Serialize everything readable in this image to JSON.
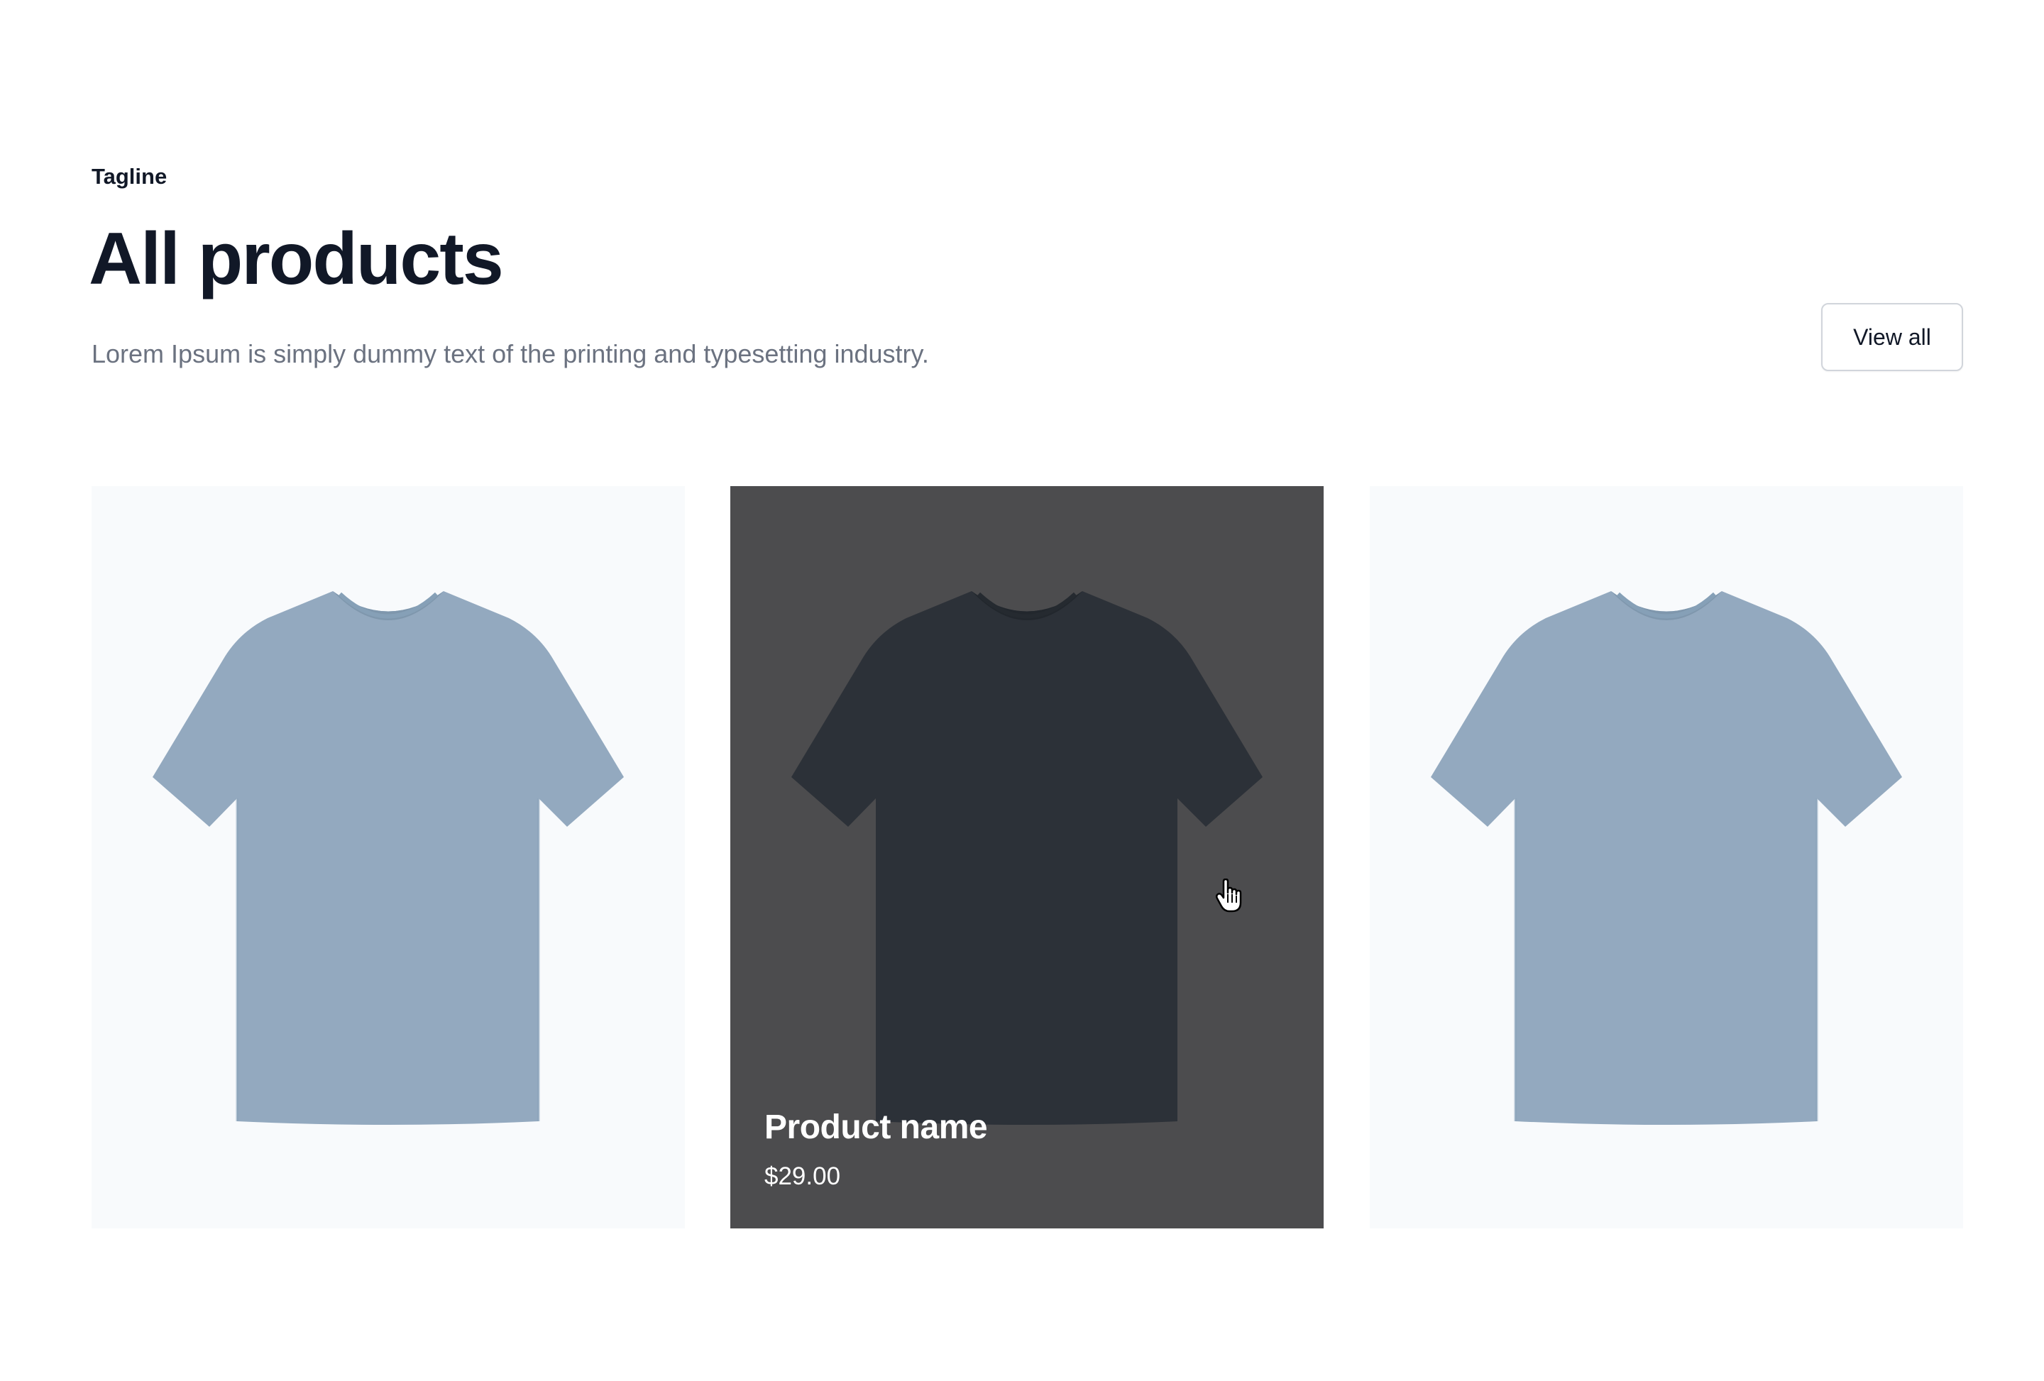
{
  "header": {
    "tagline": "Tagline",
    "title": "All products",
    "description": "Lorem Ipsum is simply dummy text of the printing and typesetting industry.",
    "view_all_label": "View all"
  },
  "products": [
    {
      "shirt_color": "#93a9bf",
      "image": "tshirt-image"
    },
    {
      "shirt_color": "#2c3138",
      "image": "tshirt-image",
      "name": "Product name",
      "price": "$29.00",
      "hovered": true
    },
    {
      "shirt_color": "#93a9bf",
      "image": "tshirt-image"
    }
  ],
  "colors": {
    "text_primary": "#111827",
    "text_muted": "#6b7280",
    "card_bg": "#f8fafc",
    "card_hover_bg": "#4c4c4e"
  },
  "cursor": {
    "icon": "pointer-hand-icon"
  }
}
